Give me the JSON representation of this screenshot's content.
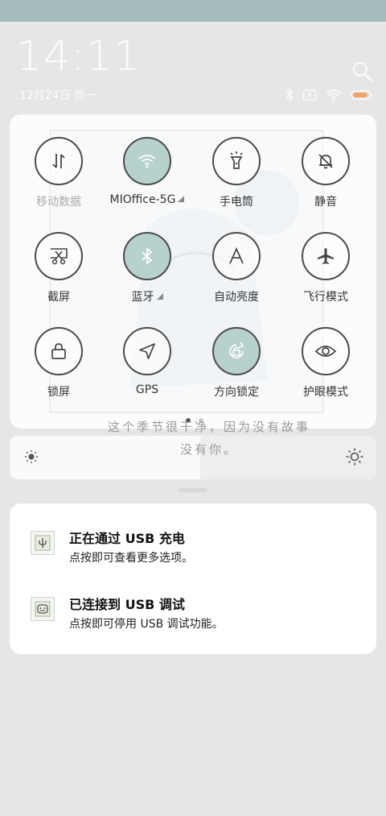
{
  "status": {
    "time": "14:11",
    "date": "12月24日 周一",
    "battery_color": "#f2a36b"
  },
  "colors": {
    "tile_on": "#b6d1ce",
    "top_band": "#a6bcbc"
  },
  "quick_settings": {
    "tiles": [
      {
        "label": "移动数据",
        "icon": "mobile-data-icon",
        "state": "off"
      },
      {
        "label": "MIOffice-5G",
        "icon": "wifi-icon",
        "state": "on",
        "expandable": true
      },
      {
        "label": "手电筒",
        "icon": "flashlight-icon",
        "state": "off"
      },
      {
        "label": "静音",
        "icon": "mute-bell-icon",
        "state": "off"
      },
      {
        "label": "截屏",
        "icon": "screenshot-icon",
        "state": "off"
      },
      {
        "label": "蓝牙",
        "icon": "bluetooth-icon",
        "state": "on",
        "expandable": true
      },
      {
        "label": "自动亮度",
        "icon": "auto-brightness-icon",
        "state": "off"
      },
      {
        "label": "飞行模式",
        "icon": "airplane-icon",
        "state": "off"
      },
      {
        "label": "锁屏",
        "icon": "lock-icon",
        "state": "off"
      },
      {
        "label": "GPS",
        "icon": "location-arrow-icon",
        "state": "off"
      },
      {
        "label": "方向锁定",
        "icon": "rotation-lock-icon",
        "state": "on"
      },
      {
        "label": "护眼模式",
        "icon": "eye-icon",
        "state": "off"
      }
    ],
    "pages": 2,
    "current_page": 1
  },
  "brightness": {
    "level": 0.52
  },
  "background_text": "这个季节很干净，因为没有故事没有你。",
  "notifications": [
    {
      "title": "正在通过 USB 充电",
      "body": "点按即可查看更多选项。",
      "icon": "usb-charge-icon"
    },
    {
      "title": "已连接到 USB 调试",
      "body": "点按即可停用 USB 调试功能。",
      "icon": "android-debug-icon"
    }
  ]
}
